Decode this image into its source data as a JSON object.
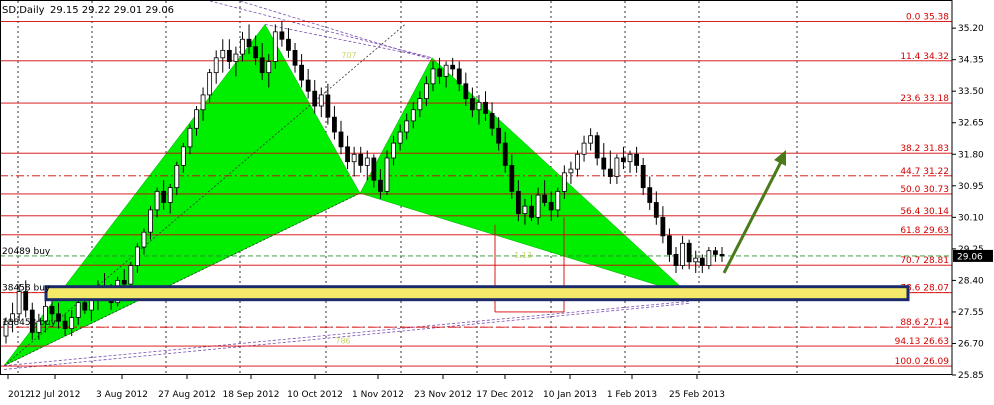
{
  "header": {
    "symbol": "SD,Daily",
    "ohlc": "29.15 29.22 29.01 29.06"
  },
  "colors": {
    "grid": "#000000",
    "fib_line": "#d40000",
    "fib_text": "#d40000",
    "pattern_fill": "#00ee00",
    "candle": "#000000",
    "zone_fill": "#f5e96a",
    "zone_border": "#1b2a6b",
    "arrow": "#4a7a1a",
    "current_price_bg": "#000000",
    "dashed_purple": "#7a4fb0",
    "buy_line": "#2e8b2e",
    "label_yellow": "#c8d86a"
  },
  "chart_data": {
    "type": "candlestick",
    "ylim": [
      25.85,
      35.5
    ],
    "y_ticks": [
      35.2,
      34.35,
      33.5,
      32.65,
      31.8,
      30.95,
      30.1,
      29.25,
      28.4,
      27.55,
      26.7,
      25.85
    ],
    "y_tick_labels": [
      "35.20",
      "34.35",
      "33.50",
      "32.65",
      "31.80",
      "30.95",
      "30.10",
      "29.25",
      "28.40",
      "27.55",
      "26.70",
      "25.85"
    ],
    "x_tick_labels": [
      "2012",
      "12 Jul 2012",
      "3 Aug 2012",
      "27 Aug 2012",
      "18 Sep 2012",
      "10 Oct 2012",
      "1 Nov 2012",
      "23 Nov 2012",
      "17 Dec 2012",
      "10 Jan 2013",
      "1 Feb 2013",
      "25 Feb 2013"
    ],
    "current_price": "29.06",
    "fib_levels": [
      {
        "label": "0.0 35.38",
        "price": 35.38,
        "style": "solid"
      },
      {
        "label": "11.4 34.32",
        "price": 34.32,
        "style": "solid"
      },
      {
        "label": "23.6 33.18",
        "price": 33.18,
        "style": "solid"
      },
      {
        "label": "38.2 31.83",
        "price": 31.83,
        "style": "solid"
      },
      {
        "label": "44.7 31.22",
        "price": 31.22,
        "style": "dashdot"
      },
      {
        "label": "50.0 30.73",
        "price": 30.73,
        "style": "solid"
      },
      {
        "label": "56.4 30.14",
        "price": 30.14,
        "style": "solid"
      },
      {
        "label": "61.8 29.63",
        "price": 29.63,
        "style": "solid"
      },
      {
        "label": "70.7 28.81",
        "price": 28.81,
        "style": "solid"
      },
      {
        "label": "78.6 28.07",
        "price": 28.07,
        "style": "solid"
      },
      {
        "label": "88.6 27.14",
        "price": 27.14,
        "style": "dashdot"
      },
      {
        "label": "94.13 26.63",
        "price": 26.63,
        "style": "solid"
      },
      {
        "label": "100.0 26.09",
        "price": 26.09,
        "style": "solid"
      }
    ],
    "order_labels": [
      {
        "text": "20489 buy",
        "price": 29.06
      },
      {
        "text": "38458 buy",
        "price": 28.07
      },
      {
        "text": "188458 buy",
        "price": 27.14
      }
    ],
    "pattern_labels": [
      "707",
      "786",
      "1.13"
    ],
    "candles": [
      [
        26.9,
        27.4,
        26.7,
        27.3
      ],
      [
        27.3,
        27.8,
        27.0,
        27.5
      ],
      [
        27.5,
        28.3,
        27.3,
        28.1
      ],
      [
        28.1,
        28.4,
        27.4,
        27.6
      ],
      [
        27.6,
        27.8,
        26.8,
        27.0
      ],
      [
        27.0,
        27.5,
        26.8,
        27.3
      ],
      [
        27.3,
        27.9,
        27.0,
        27.7
      ],
      [
        27.7,
        28.0,
        27.3,
        27.5
      ],
      [
        27.5,
        27.8,
        27.1,
        27.3
      ],
      [
        27.3,
        27.5,
        26.9,
        27.1
      ],
      [
        27.1,
        27.6,
        26.9,
        27.4
      ],
      [
        27.4,
        27.9,
        27.2,
        27.8
      ],
      [
        27.8,
        28.2,
        27.5,
        27.6
      ],
      [
        27.6,
        28.0,
        27.3,
        27.9
      ],
      [
        27.9,
        28.4,
        27.6,
        28.2
      ],
      [
        28.2,
        28.6,
        27.9,
        28.0
      ],
      [
        28.0,
        28.3,
        27.6,
        27.8
      ],
      [
        27.8,
        28.5,
        27.7,
        28.4
      ],
      [
        28.4,
        28.7,
        28.1,
        28.3
      ],
      [
        28.3,
        28.9,
        28.2,
        28.8
      ],
      [
        28.8,
        29.4,
        28.6,
        29.3
      ],
      [
        29.3,
        29.8,
        29.1,
        29.7
      ],
      [
        29.7,
        30.4,
        29.5,
        30.3
      ],
      [
        30.3,
        30.9,
        30.1,
        30.8
      ],
      [
        30.8,
        31.1,
        30.3,
        30.5
      ],
      [
        30.5,
        31.0,
        30.2,
        30.9
      ],
      [
        30.9,
        31.6,
        30.7,
        31.5
      ],
      [
        31.5,
        32.1,
        31.3,
        32.0
      ],
      [
        32.0,
        32.6,
        31.8,
        32.5
      ],
      [
        32.5,
        33.1,
        32.3,
        33.0
      ],
      [
        33.0,
        33.6,
        32.7,
        33.4
      ],
      [
        33.4,
        34.1,
        33.2,
        34.0
      ],
      [
        34.0,
        34.6,
        33.7,
        34.4
      ],
      [
        34.4,
        34.9,
        34.0,
        34.6
      ],
      [
        34.6,
        34.9,
        34.1,
        34.3
      ],
      [
        34.3,
        34.7,
        33.9,
        34.5
      ],
      [
        34.5,
        35.1,
        34.3,
        34.9
      ],
      [
        34.9,
        35.3,
        34.5,
        34.7
      ],
      [
        34.7,
        35.0,
        34.2,
        34.4
      ],
      [
        34.4,
        34.8,
        33.8,
        34.0
      ],
      [
        34.0,
        34.5,
        33.6,
        34.3
      ],
      [
        34.3,
        35.3,
        34.1,
        35.1
      ],
      [
        35.1,
        35.4,
        34.7,
        34.9
      ],
      [
        34.9,
        35.2,
        34.4,
        34.6
      ],
      [
        34.6,
        34.8,
        34.0,
        34.2
      ],
      [
        34.2,
        34.5,
        33.6,
        33.8
      ],
      [
        33.8,
        34.1,
        33.3,
        33.5
      ],
      [
        33.5,
        33.8,
        32.9,
        33.1
      ],
      [
        33.1,
        33.6,
        32.8,
        33.4
      ],
      [
        33.4,
        33.7,
        32.6,
        32.8
      ],
      [
        32.8,
        33.1,
        32.2,
        32.4
      ],
      [
        32.4,
        32.7,
        31.8,
        32.0
      ],
      [
        32.0,
        32.3,
        31.4,
        31.6
      ],
      [
        31.6,
        32.0,
        31.2,
        31.8
      ],
      [
        31.8,
        32.0,
        31.3,
        31.5
      ],
      [
        31.5,
        31.9,
        31.1,
        31.7
      ],
      [
        31.7,
        31.8,
        30.9,
        31.1
      ],
      [
        31.1,
        31.4,
        30.6,
        30.8
      ],
      [
        30.8,
        31.9,
        30.7,
        31.7
      ],
      [
        31.7,
        32.3,
        31.5,
        32.1
      ],
      [
        32.1,
        32.6,
        31.9,
        32.4
      ],
      [
        32.4,
        32.9,
        32.2,
        32.7
      ],
      [
        32.7,
        33.2,
        32.5,
        33.0
      ],
      [
        33.0,
        33.5,
        32.8,
        33.3
      ],
      [
        33.3,
        33.9,
        33.1,
        33.7
      ],
      [
        33.7,
        34.3,
        33.5,
        34.1
      ],
      [
        34.1,
        34.4,
        33.7,
        33.9
      ],
      [
        33.9,
        34.3,
        33.6,
        34.2
      ],
      [
        34.2,
        34.4,
        33.9,
        34.1
      ],
      [
        34.1,
        34.3,
        33.5,
        33.7
      ],
      [
        33.7,
        34.0,
        33.1,
        33.3
      ],
      [
        33.3,
        33.6,
        32.8,
        33.0
      ],
      [
        33.0,
        33.4,
        32.6,
        33.2
      ],
      [
        33.2,
        33.5,
        32.7,
        32.9
      ],
      [
        32.9,
        33.2,
        32.3,
        32.5
      ],
      [
        32.5,
        32.8,
        31.9,
        32.1
      ],
      [
        32.1,
        32.4,
        31.3,
        31.5
      ],
      [
        31.5,
        31.8,
        30.6,
        30.8
      ],
      [
        30.8,
        31.1,
        30.0,
        30.2
      ],
      [
        30.2,
        30.6,
        29.9,
        30.4
      ],
      [
        30.4,
        30.7,
        30.0,
        30.1
      ],
      [
        30.1,
        30.9,
        29.9,
        30.7
      ],
      [
        30.7,
        31.1,
        30.4,
        30.5
      ],
      [
        30.5,
        30.8,
        30.0,
        30.3
      ],
      [
        30.3,
        30.9,
        30.1,
        30.8
      ],
      [
        30.8,
        31.5,
        30.6,
        31.3
      ],
      [
        31.3,
        31.6,
        31.0,
        31.4
      ],
      [
        31.4,
        31.9,
        31.2,
        31.8
      ],
      [
        31.8,
        32.3,
        31.6,
        32.1
      ],
      [
        32.1,
        32.5,
        31.9,
        32.3
      ],
      [
        32.3,
        32.4,
        31.5,
        31.7
      ],
      [
        31.7,
        32.1,
        31.2,
        31.4
      ],
      [
        31.4,
        31.9,
        31.0,
        31.2
      ],
      [
        31.2,
        31.8,
        31.0,
        31.7
      ],
      [
        31.7,
        32.0,
        31.4,
        31.6
      ],
      [
        31.6,
        31.9,
        31.3,
        31.8
      ],
      [
        31.8,
        32.0,
        31.3,
        31.5
      ],
      [
        31.5,
        31.7,
        30.7,
        30.9
      ],
      [
        30.9,
        31.2,
        30.3,
        30.5
      ],
      [
        30.5,
        30.8,
        29.9,
        30.1
      ],
      [
        30.1,
        30.4,
        29.4,
        29.6
      ],
      [
        29.6,
        29.8,
        28.9,
        29.1
      ],
      [
        29.1,
        29.3,
        28.6,
        28.8
      ],
      [
        28.8,
        29.6,
        28.7,
        29.4
      ],
      [
        29.4,
        29.5,
        28.7,
        28.9
      ],
      [
        28.9,
        29.2,
        28.6,
        29.0
      ],
      [
        29.0,
        29.1,
        28.6,
        28.8
      ],
      [
        28.8,
        29.3,
        28.7,
        29.2
      ],
      [
        29.2,
        29.3,
        28.9,
        29.1
      ],
      [
        29.1,
        29.3,
        28.9,
        29.06
      ]
    ]
  }
}
